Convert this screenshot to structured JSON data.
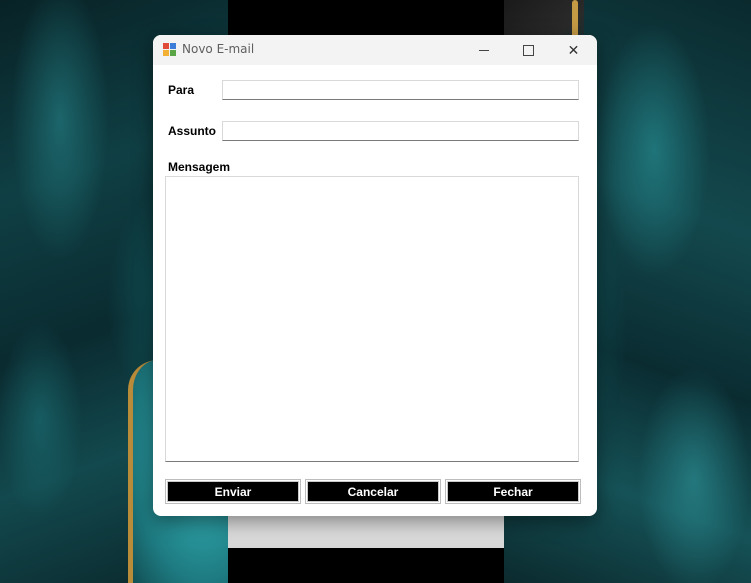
{
  "window": {
    "title": "Novo E-mail",
    "minimize_icon": "minimize-icon",
    "maximize_icon": "maximize-icon",
    "close_icon": "close-icon",
    "close_glyph": "✕"
  },
  "form": {
    "to_label": "Para",
    "to_value": "",
    "subject_label": "Assunto",
    "subject_value": "",
    "message_label": "Mensagem",
    "message_value": ""
  },
  "buttons": {
    "send": "Enviar",
    "cancel": "Cancelar",
    "close": "Fechar"
  },
  "colors": {
    "button_bg": "#000000",
    "button_text": "#ffffff",
    "titlebar_bg": "#f3f3f3"
  }
}
